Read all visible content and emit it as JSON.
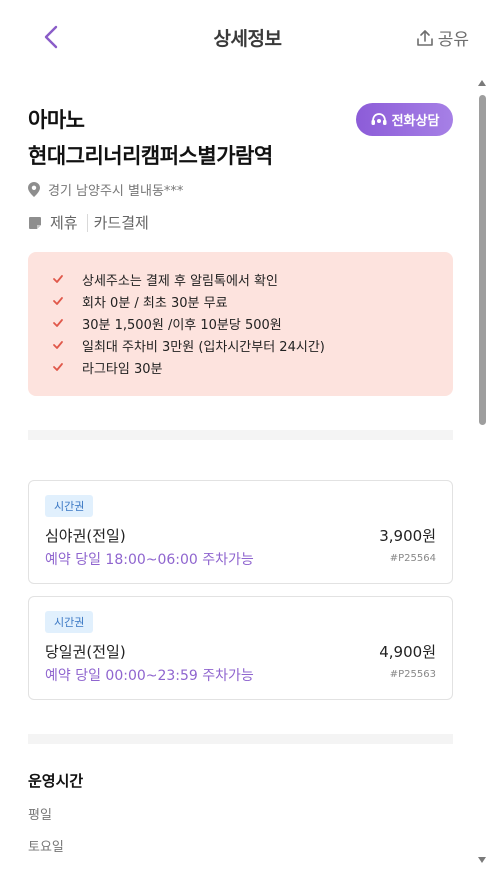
{
  "header": {
    "title": "상세정보",
    "share_label": "공유"
  },
  "lot": {
    "name_line1": "아마노",
    "name_line2": "현대그리너리캠퍼스별가람역",
    "call_button": "전화상담",
    "address": "경기 남양주시 별내동***",
    "tags": [
      "제휴",
      "카드결제"
    ]
  },
  "notice": {
    "items": [
      "상세주소는 결제 후 알림톡에서 확인",
      "회차 0분 / 최초 30분 무료",
      "30분 1,500원 /이후 10분당 500원",
      "일최대 주차비 3만원 (입차시간부터 24시간)",
      "라그타임 30분"
    ]
  },
  "tickets": [
    {
      "badge": "시간권",
      "name": "심야권(전일)",
      "price": "3,900원",
      "time": "예약 당일 18:00~06:00 주차가능",
      "code": "#P25564"
    },
    {
      "badge": "시간권",
      "name": "당일권(전일)",
      "price": "4,900원",
      "time": "예약 당일 00:00~23:59 주차가능",
      "code": "#P25563"
    }
  ],
  "hours": {
    "title": "운영시간",
    "labels": [
      "평일",
      "토요일"
    ]
  },
  "colors": {
    "accent_purple": "#8f65cf",
    "notice_bg": "#fde3de",
    "check_red": "#e0584a",
    "badge_bg": "#e1f0fd"
  }
}
